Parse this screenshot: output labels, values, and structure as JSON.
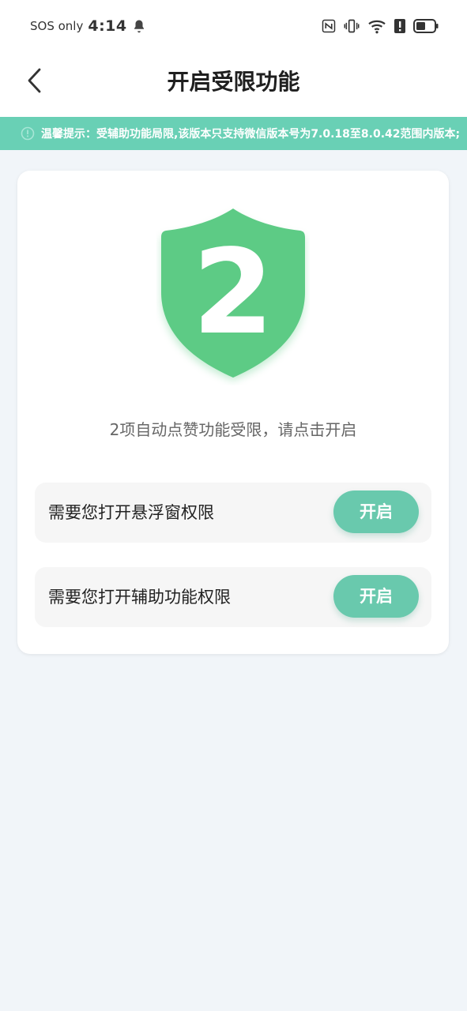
{
  "status_bar": {
    "carrier": "SOS only",
    "time": "4:14",
    "icons": [
      "bell-icon",
      "nfc-icon",
      "vibrate-icon",
      "wifi-icon",
      "alert-icon",
      "battery-icon"
    ]
  },
  "header": {
    "title": "开启受限功能",
    "back_icon": "chevron-left-icon"
  },
  "notice": {
    "icon": "info-icon",
    "text": "温馨提示：受辅助功能局限,该版本只支持微信版本号为7.0.18至8.0.42范围内版本;"
  },
  "card": {
    "shield_number": "2",
    "subtitle": "2项自动点赞功能受限，请点击开启",
    "permissions": [
      {
        "label": "需要您打开悬浮窗权限",
        "button": "开启"
      },
      {
        "label": "需要您打开辅助功能权限",
        "button": "开启"
      }
    ]
  },
  "colors": {
    "accent": "#69c9ad",
    "notice_bg": "#69d0b5",
    "shield": "#5dcb85",
    "page_bg": "#f1f5f9"
  }
}
